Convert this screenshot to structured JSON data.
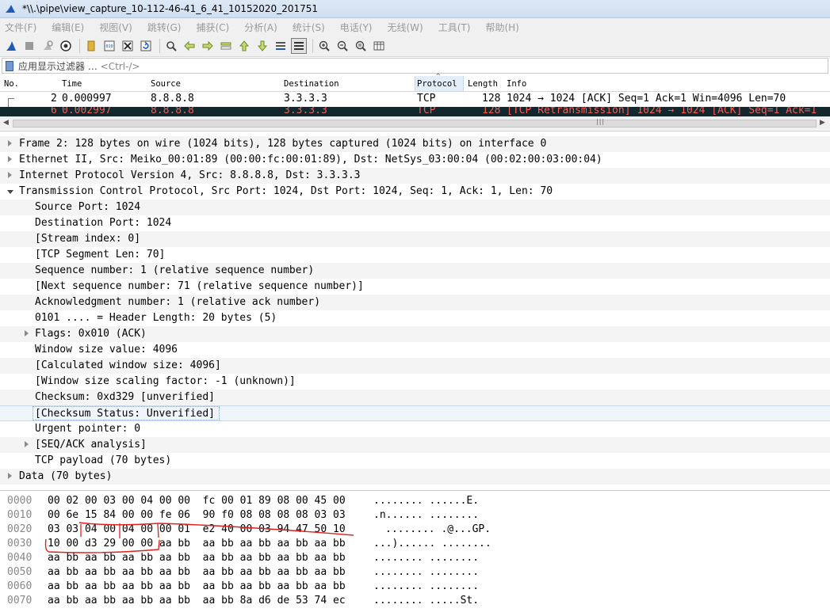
{
  "window": {
    "title": "*\\\\.\\pipe\\view_capture_10-112-46-41_6_41_10152020_201751"
  },
  "menu": [
    "文件(F)",
    "编辑(E)",
    "视图(V)",
    "跳转(G)",
    "捕获(C)",
    "分析(A)",
    "统计(S)",
    "电话(Y)",
    "无线(W)",
    "工具(T)",
    "帮助(H)"
  ],
  "filter": {
    "label": "应用显示过滤器 …",
    "placeholder": "<Ctrl-/>"
  },
  "packet_list": {
    "columns": [
      "No.",
      "Time",
      "Source",
      "Destination",
      "Protocol",
      "Length",
      "Info"
    ],
    "rows": [
      {
        "no": "2",
        "time": "0.000997",
        "source": "8.8.8.8",
        "destination": "3.3.3.3",
        "protocol": "TCP",
        "length": "128",
        "info": "1024 → 1024 [ACK] Seq=1 Ack=1 Win=4096 Len=70"
      },
      {
        "no": "6",
        "time": "0.002997",
        "source": "8.8.8.8",
        "destination": "3.3.3.3",
        "protocol": "TCP",
        "length": "128",
        "info": "[TCP Retransmission] 1024 → 1024 [ACK] Seq=1 Ack=1"
      }
    ]
  },
  "details": [
    {
      "text": "Frame 2: 128 bytes on wire (1024 bits), 128 bytes captured (1024 bits) on interface 0",
      "level": 0,
      "toggle": "collapsed"
    },
    {
      "text": "Ethernet II, Src: Meiko_00:01:89 (00:00:fc:00:01:89), Dst: NetSys_03:00:04 (00:02:00:03:00:04)",
      "level": 0,
      "toggle": "collapsed"
    },
    {
      "text": "Internet Protocol Version 4, Src: 8.8.8.8, Dst: 3.3.3.3",
      "level": 0,
      "toggle": "collapsed"
    },
    {
      "text": "Transmission Control Protocol, Src Port: 1024, Dst Port: 1024, Seq: 1, Ack: 1, Len: 70",
      "level": 0,
      "toggle": "expanded"
    },
    {
      "text": "Source Port: 1024",
      "level": 1,
      "toggle": "none"
    },
    {
      "text": "Destination Port: 1024",
      "level": 1,
      "toggle": "none"
    },
    {
      "text": "[Stream index: 0]",
      "level": 1,
      "toggle": "none"
    },
    {
      "text": "[TCP Segment Len: 70]",
      "level": 1,
      "toggle": "none"
    },
    {
      "text": "Sequence number: 1    (relative sequence number)",
      "level": 1,
      "toggle": "none"
    },
    {
      "text": "[Next sequence number: 71    (relative sequence number)]",
      "level": 1,
      "toggle": "none"
    },
    {
      "text": "Acknowledgment number: 1    (relative ack number)",
      "level": 1,
      "toggle": "none"
    },
    {
      "text": "0101 .... = Header Length: 20 bytes (5)",
      "level": 1,
      "toggle": "none"
    },
    {
      "text": "Flags: 0x010 (ACK)",
      "level": 1,
      "toggle": "collapsed"
    },
    {
      "text": "Window size value: 4096",
      "level": 1,
      "toggle": "none"
    },
    {
      "text": "[Calculated window size: 4096]",
      "level": 1,
      "toggle": "none"
    },
    {
      "text": "[Window size scaling factor: -1 (unknown)]",
      "level": 1,
      "toggle": "none"
    },
    {
      "text": "Checksum: 0xd329 [unverified]",
      "level": 1,
      "toggle": "none"
    },
    {
      "text": "[Checksum Status: Unverified]",
      "level": 1,
      "toggle": "none",
      "selected": true
    },
    {
      "text": "Urgent pointer: 0",
      "level": 1,
      "toggle": "none"
    },
    {
      "text": "[SEQ/ACK analysis]",
      "level": 1,
      "toggle": "collapsed"
    },
    {
      "text": "TCP payload (70 bytes)",
      "level": 1,
      "toggle": "none"
    },
    {
      "text": "Data (70 bytes)",
      "level": 0,
      "toggle": "collapsed"
    }
  ],
  "bytes": [
    {
      "offset": "0000",
      "hex": "00 02 00 03 00 04 00 00  fc 00 01 89 08 00 45 00",
      "ascii": "........ ......E."
    },
    {
      "offset": "0010",
      "hex": "00 6e 15 84 00 00 fe 06  90 f0 08 08 08 08 03 03",
      "ascii": ".n...... ........"
    },
    {
      "offset": "0020",
      "hex": "03 03 04 00 04 00 00 01  e2 40 00 03 94 47 50 10",
      "ascii": "........ .@...GP."
    },
    {
      "offset": "0030",
      "hex": "10 00 d3 29 00 00 aa bb  aa bb aa bb aa bb aa bb",
      "ascii": "...)...... ........"
    },
    {
      "offset": "0040",
      "hex": "aa bb aa bb aa bb aa bb  aa bb aa bb aa bb aa bb",
      "ascii": "........ ........"
    },
    {
      "offset": "0050",
      "hex": "aa bb aa bb aa bb aa bb  aa bb aa bb aa bb aa bb",
      "ascii": "........ ........"
    },
    {
      "offset": "0060",
      "hex": "aa bb aa bb aa bb aa bb  aa bb aa bb aa bb aa bb",
      "ascii": "........ ........"
    },
    {
      "offset": "0070",
      "hex": "aa bb aa bb aa bb aa bb  aa bb 8a d6 de 53 74 ec",
      "ascii": "........ .....St."
    }
  ],
  "icons": {
    "toolbar": [
      "start-capture-icon",
      "stop-capture-icon",
      "restart-capture-icon",
      "capture-options-icon",
      "open-file-icon",
      "save-file-icon",
      "close-file-icon",
      "reload-file-icon",
      "find-packet-icon",
      "go-back-icon",
      "go-forward-icon",
      "go-to-packet-icon",
      "go-first-icon",
      "go-last-icon",
      "autoscroll-icon",
      "colorize-icon",
      "zoom-in-icon",
      "zoom-out-icon",
      "zoom-normal-icon",
      "resize-columns-icon"
    ]
  },
  "colors": {
    "selected_row_bg": "#12272e",
    "selected_row_fg": "#f25c54",
    "annotation": "#e0201b"
  }
}
